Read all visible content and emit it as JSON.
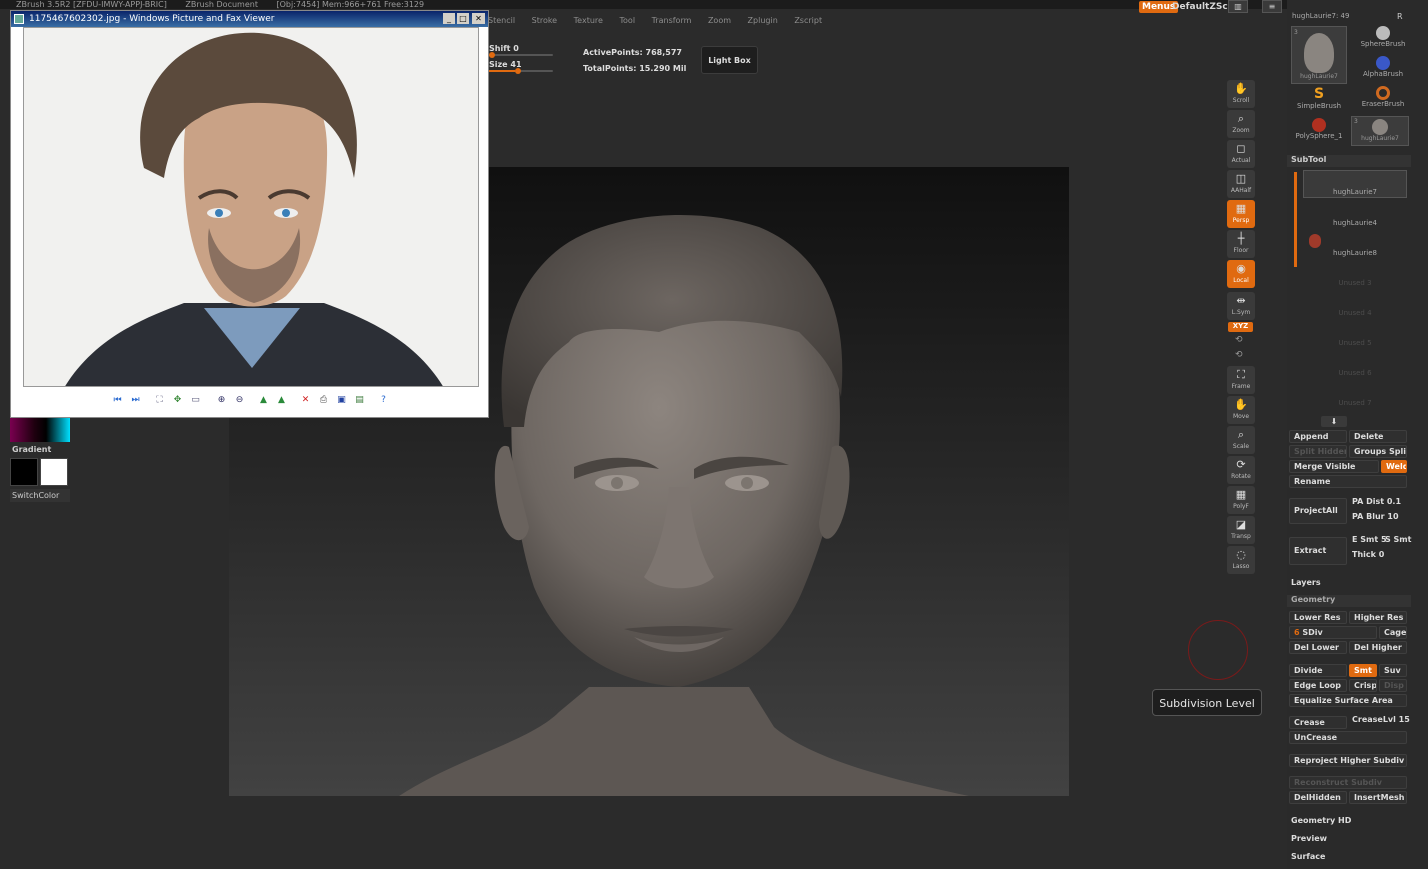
{
  "app_title": {
    "left": "ZBrush 3.5R2 [ZFDU-IMWY-APPJ-BRIC]",
    "doc": "ZBrush Document",
    "stats": "[Obj:7454] Mem:966+761 Free:3129"
  },
  "menus": [
    "Stencil",
    "Stroke",
    "Texture",
    "Tool",
    "Transform",
    "Zoom",
    "Zplugin",
    "Zscript"
  ],
  "top_right": {
    "menus_label": "Menus",
    "script_label": "DefaultZScript",
    "current_tool": "hughLaurie7: 49",
    "r_label": "R"
  },
  "toolbar": {
    "shift_label": "Shift 0",
    "shift_value": 0,
    "size_label": "Size 41",
    "size_value": 0.41,
    "active_points": "ActivePoints: 768,577",
    "total_points": "TotalPoints: 15.290 Mil",
    "light_box": "Light Box"
  },
  "viewer": {
    "title": "1175467602302.jpg - Windows Picture and Fax Viewer",
    "min": "_",
    "max": "□",
    "close": "✕"
  },
  "left": {
    "gradient": "Gradient",
    "switch_color": "SwitchColor"
  },
  "tools": [
    {
      "label": "Scroll",
      "icon": "✋",
      "on": false
    },
    {
      "label": "Zoom",
      "icon": "🔍",
      "on": false
    },
    {
      "label": "Actual",
      "icon": "◻",
      "on": false
    },
    {
      "label": "AAHalf",
      "icon": "◫",
      "on": false
    },
    {
      "label": "Persp",
      "icon": "▦",
      "on": true
    },
    {
      "label": "Floor",
      "icon": "┼",
      "on": false
    },
    {
      "label": "Local",
      "icon": "◉",
      "on": true
    },
    {
      "label": "L.Sym",
      "icon": "⇹",
      "on": false
    },
    {
      "label": "Frame",
      "icon": "⛶",
      "on": false
    },
    {
      "label": "Move",
      "icon": "✋",
      "on": false
    },
    {
      "label": "Scale",
      "icon": "🔍",
      "on": false
    },
    {
      "label": "Rotate",
      "icon": "⟳",
      "on": false
    },
    {
      "label": "PolyF",
      "icon": "▦",
      "on": false
    },
    {
      "label": "Transp",
      "icon": "◪",
      "on": false
    },
    {
      "label": "Lasso",
      "icon": "◌",
      "on": false
    }
  ],
  "xyz_label": "XYZ",
  "brushes": [
    {
      "label": "hughLaurie7",
      "count": "3"
    },
    {
      "label": "SphereBrush"
    },
    {
      "label": "AlphaBrush"
    },
    {
      "label": "SimpleBrush"
    },
    {
      "label": "EraserBrush"
    },
    {
      "label": "PolySphere_1"
    },
    {
      "label": "hughLaurie7",
      "count": "3"
    }
  ],
  "subtool": {
    "title": "SubTool",
    "items": [
      {
        "name": "hughLaurie7",
        "enabled": true
      },
      {
        "name": "hughLaurie4",
        "enabled": true
      },
      {
        "name": "hughLaurie8",
        "enabled": true
      },
      {
        "name": "Unused 3",
        "enabled": false
      },
      {
        "name": "Unused 4",
        "enabled": false
      },
      {
        "name": "Unused 5",
        "enabled": false
      },
      {
        "name": "Unused 6",
        "enabled": false
      },
      {
        "name": "Unused 7",
        "enabled": false
      }
    ],
    "append": "Append",
    "delete": "Delete",
    "split_hidden": "Split Hidden",
    "groups_split": "Groups Split",
    "merge_visible": "Merge Visible",
    "weld": "Weld",
    "rename": "Rename",
    "project_all": "ProjectAll",
    "pa_dist": "PA Dist 0.1",
    "pa_blur": "PA Blur 10",
    "extract": "Extract",
    "e_smt": "E Smt 5",
    "s_smt": "S Smt",
    "thick": "Thick 0"
  },
  "layers": "Layers",
  "geometry": {
    "title": "Geometry",
    "lower_res": "Lower Res",
    "higher_res": "Higher Res",
    "sdiv_value": "6",
    "sdiv_label": "SDiv",
    "cage": "Cage",
    "del_lower": "Del Lower",
    "del_higher": "Del Higher",
    "divide": "Divide",
    "smt": "Smt",
    "suv": "Suv",
    "edge_loop": "Edge Loop",
    "crisp": "Crisp",
    "disp": "Disp",
    "equalize": "Equalize Surface Area",
    "crease": "Crease",
    "crease_lvl": "CreaseLvl 15",
    "uncrease": "UnCrease",
    "reproject": "Reproject Higher Subdiv",
    "reconstruct": "Reconstruct Subdiv",
    "del_hidden": "DelHidden",
    "insert_mesh": "InsertMesh"
  },
  "geometry_hd": "Geometry HD",
  "preview": "Preview",
  "surface": "Surface",
  "tooltip": "Subdivision Level",
  "colors": {
    "accent": "#e06a10",
    "bg": "#2b2b2b",
    "panel": "#2a2a2a"
  }
}
